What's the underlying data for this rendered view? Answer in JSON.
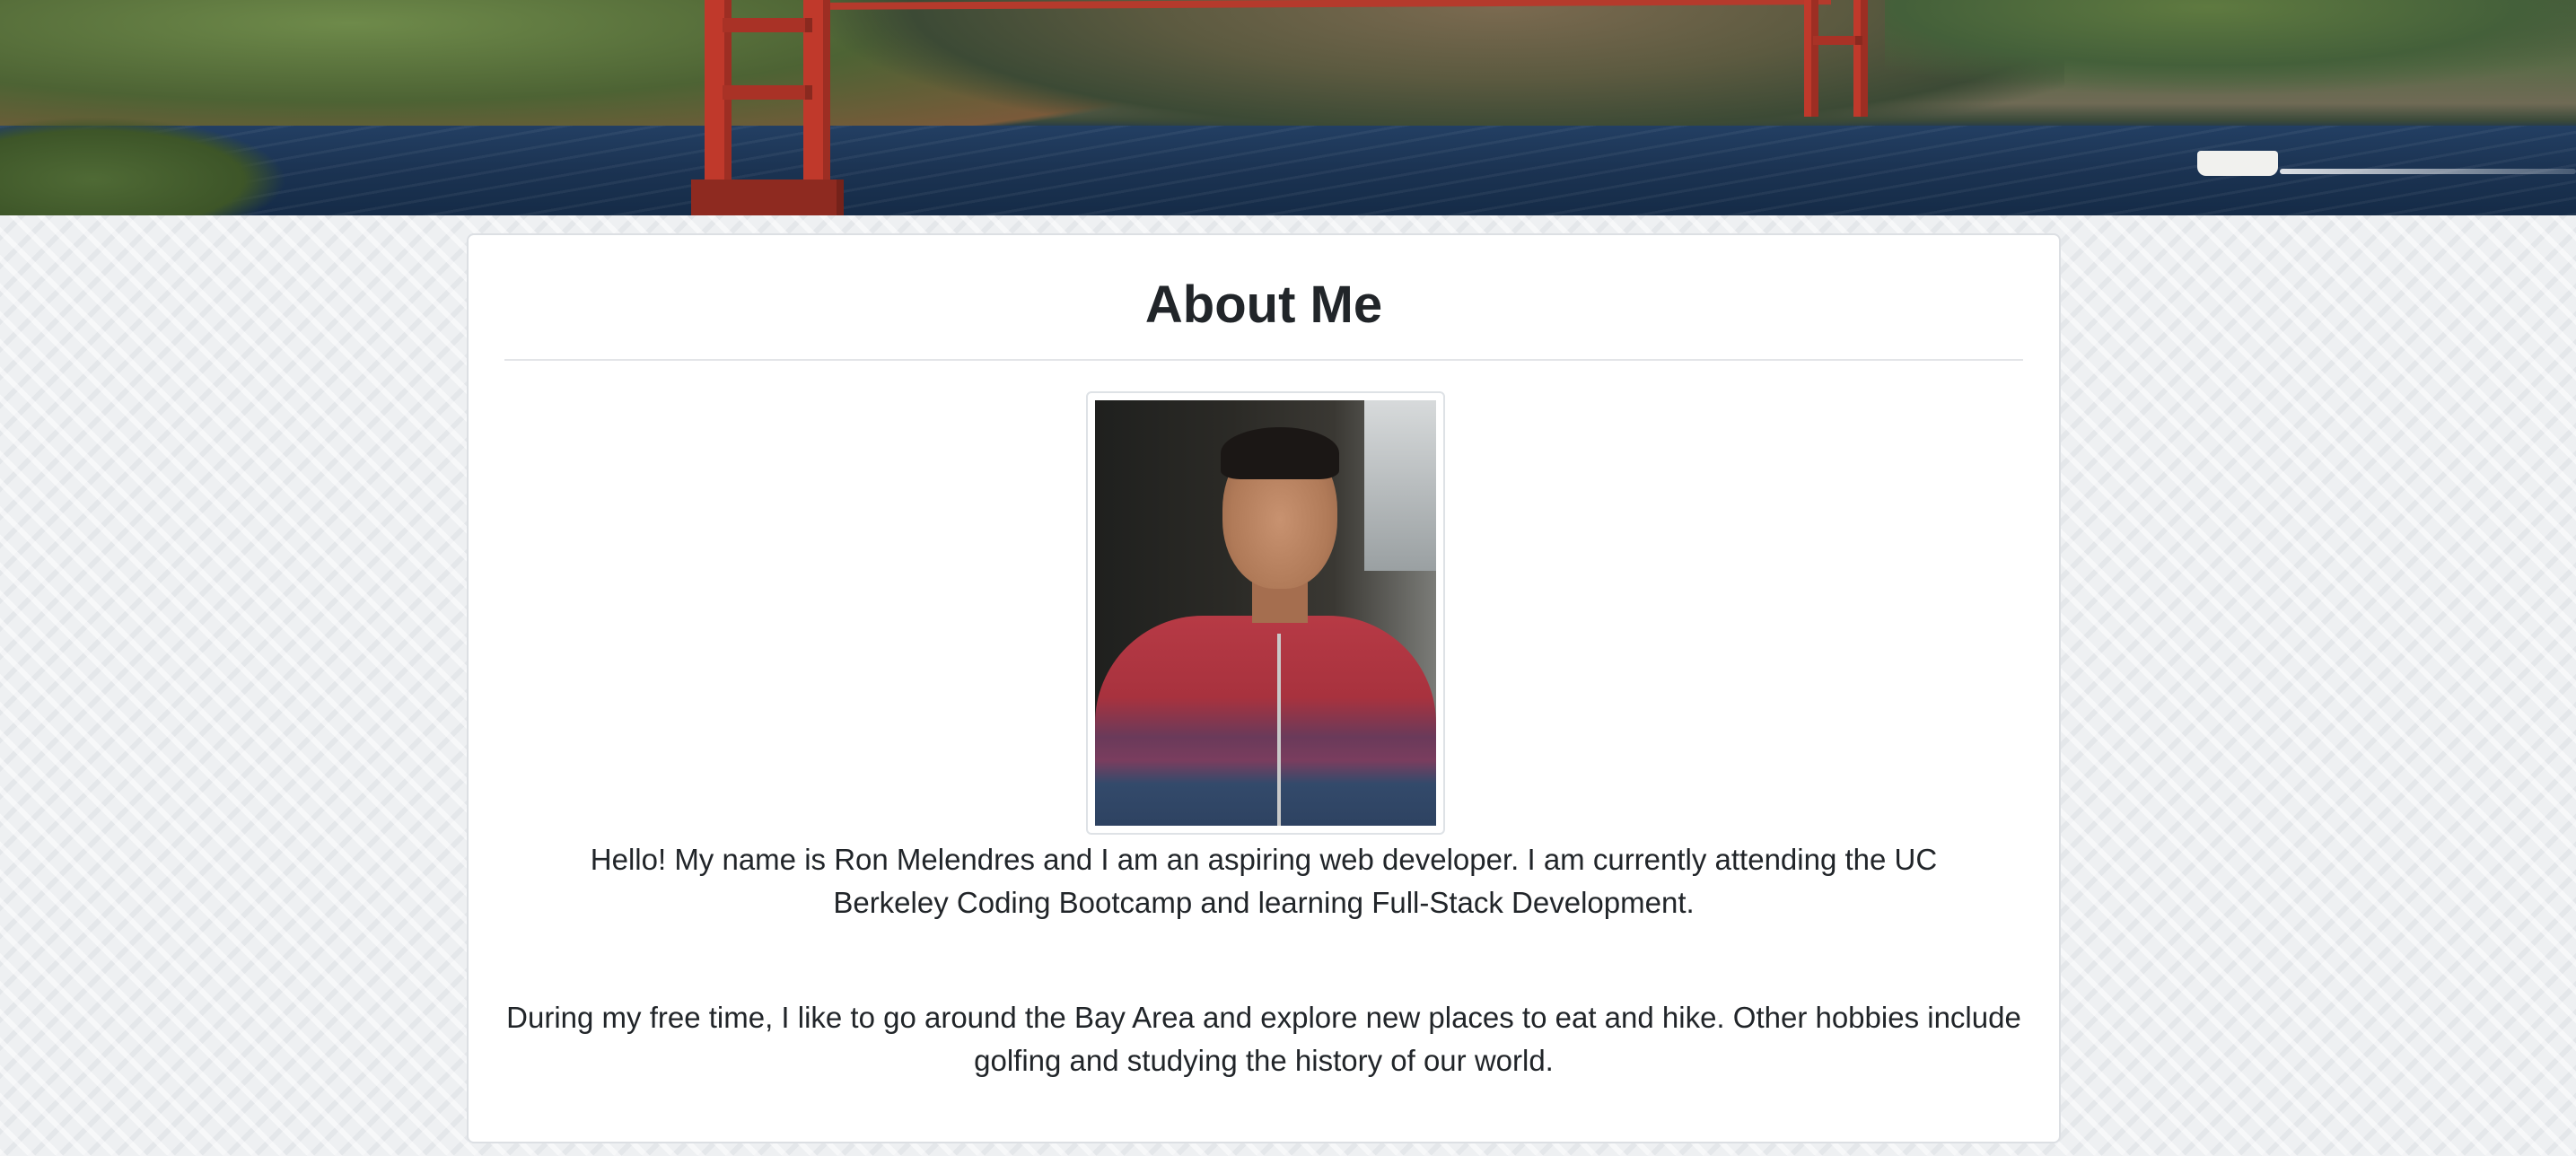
{
  "banner": {
    "image": "golden-gate-bridge-photo"
  },
  "card": {
    "title": "About Me",
    "portrait": "profile-photo",
    "paragraphs": [
      "Hello! My name is Ron Melendres and I am an aspiring web developer. I am currently attending the UC Berkeley Coding Bootcamp and learning Full-Stack Development.",
      "During my free time, I like to go around the Bay Area and explore new places to eat and hike. Other hobbies include golfing and studying the history of our world."
    ]
  },
  "colors": {
    "card_border": "#dcdfe3",
    "text": "#212529",
    "page_bg": "#eef0f2"
  }
}
